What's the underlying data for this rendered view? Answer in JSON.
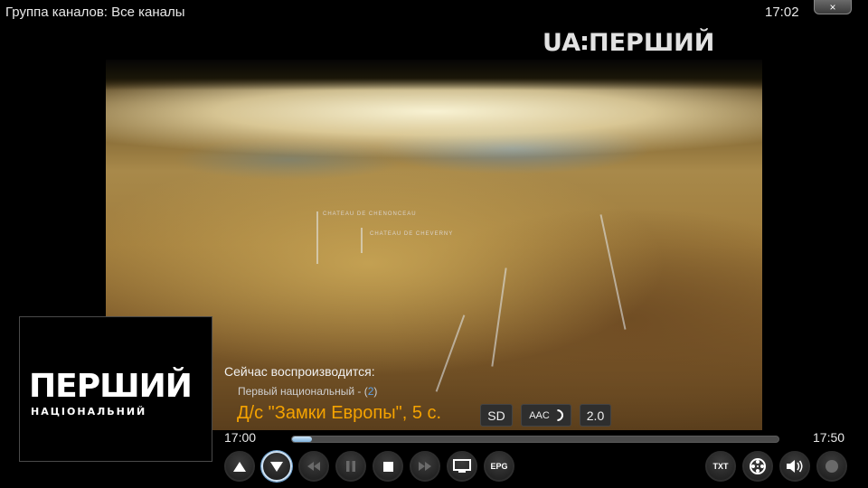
{
  "header": {
    "group_label": "Группа каналов: Все каналы",
    "clock": "17:02",
    "close_symbol": "×"
  },
  "channel_logo": {
    "left": "UA",
    "right": "ПЕРШИЙ"
  },
  "video_map_labels": [
    "CHATEAU DE CHENONCEAU",
    "CHATEAU DE CHEVERNY"
  ],
  "thumbnail": {
    "logo_main": "ПЕРШИЙ",
    "logo_sub": "НАЦІОНАЛЬНИЙ"
  },
  "info": {
    "now_playing_label": "Сейчас воспроизводится:",
    "channel_name": "Первый национальный - (",
    "channel_number": "2",
    "channel_name_end": ")",
    "program_title": "Д/с \"Замки Европы\", 5 с.",
    "tag_quality": "SD",
    "tag_audio": "AAC",
    "tag_channels": "2.0"
  },
  "progress": {
    "start_time": "17:00",
    "end_time": "17:50",
    "fraction": 0.04
  },
  "controls": {
    "epg_label": "EPG",
    "txt_label": "TXT"
  },
  "colors": {
    "accent_orange": "#f5a300",
    "channel_number_blue": "#5aa0e8"
  }
}
